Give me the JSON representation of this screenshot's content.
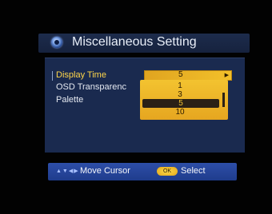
{
  "title": "Miscellaneous Setting",
  "menu": {
    "items": [
      "Display Time",
      "OSD Transparenc",
      "Palette"
    ]
  },
  "dropdown": {
    "selected_value": "5",
    "options": [
      "1",
      "3",
      "5",
      "10"
    ]
  },
  "footer": {
    "move_label": "Move Cursor",
    "ok_label": "OK",
    "select_label": "Select"
  },
  "colors": {
    "panel_bg": "#1a2a4f",
    "accent_yellow": "#f3c330",
    "footer_blue": "#2d4ea8"
  }
}
